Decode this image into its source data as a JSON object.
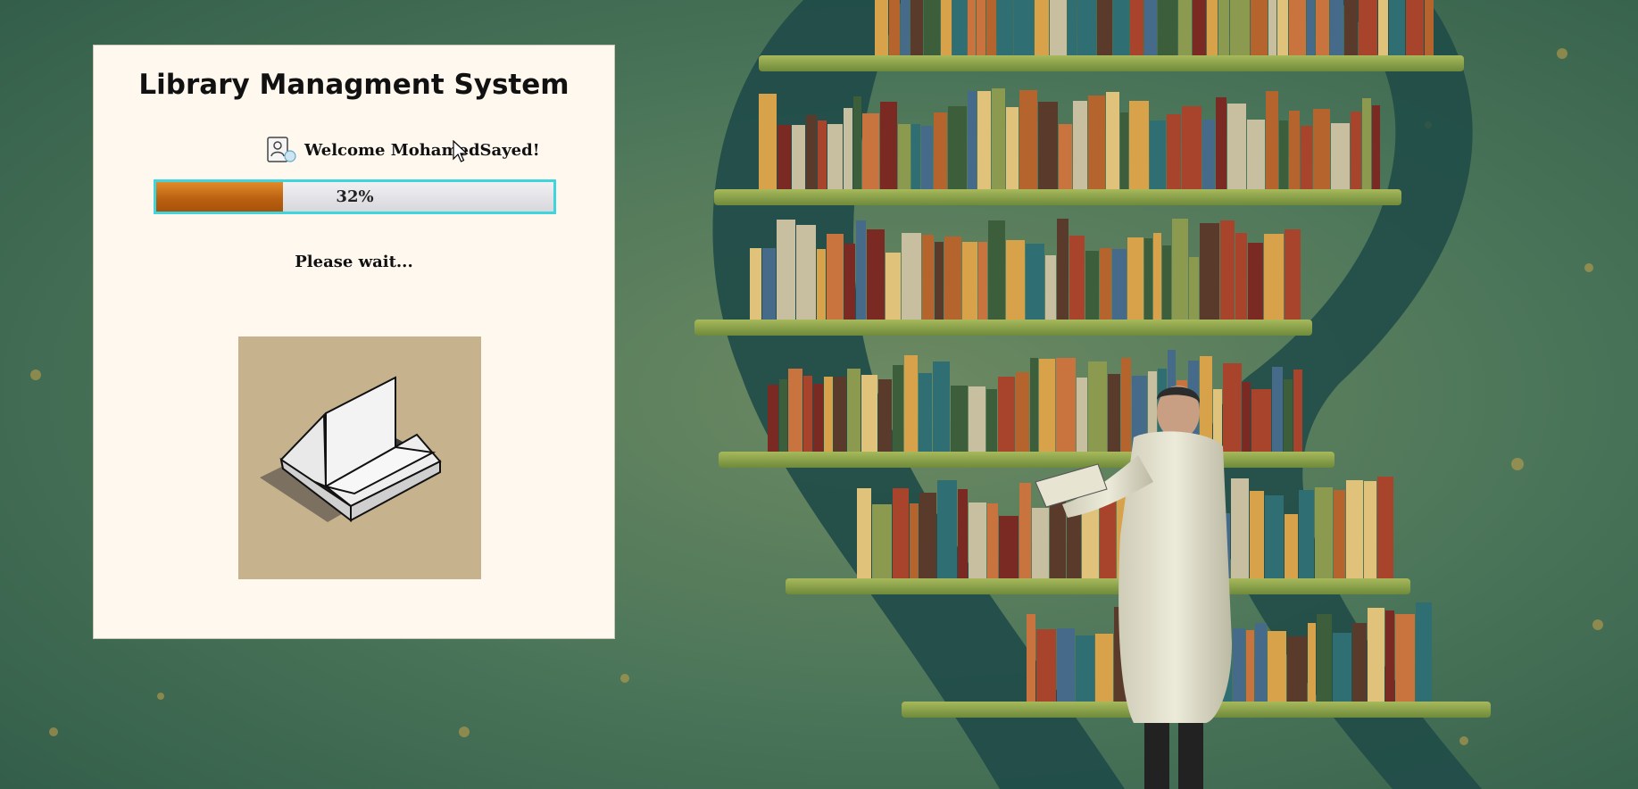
{
  "splash": {
    "title": "Library Managment System",
    "welcome": "Welcome MohamedSayed!",
    "status": "Please wait...",
    "progress": {
      "percent": 32,
      "label": "32%",
      "fill_color": "#b85f10",
      "border_color": "#3ed6dc"
    },
    "icons": {
      "user": "user-card-icon",
      "book": "open-book-icon",
      "cursor": "mouse-pointer-icon"
    }
  },
  "background": {
    "description_colors": {
      "wall": "#3f6a55",
      "shelf": "#8aa44a",
      "coat": "#e4e1cf"
    }
  }
}
